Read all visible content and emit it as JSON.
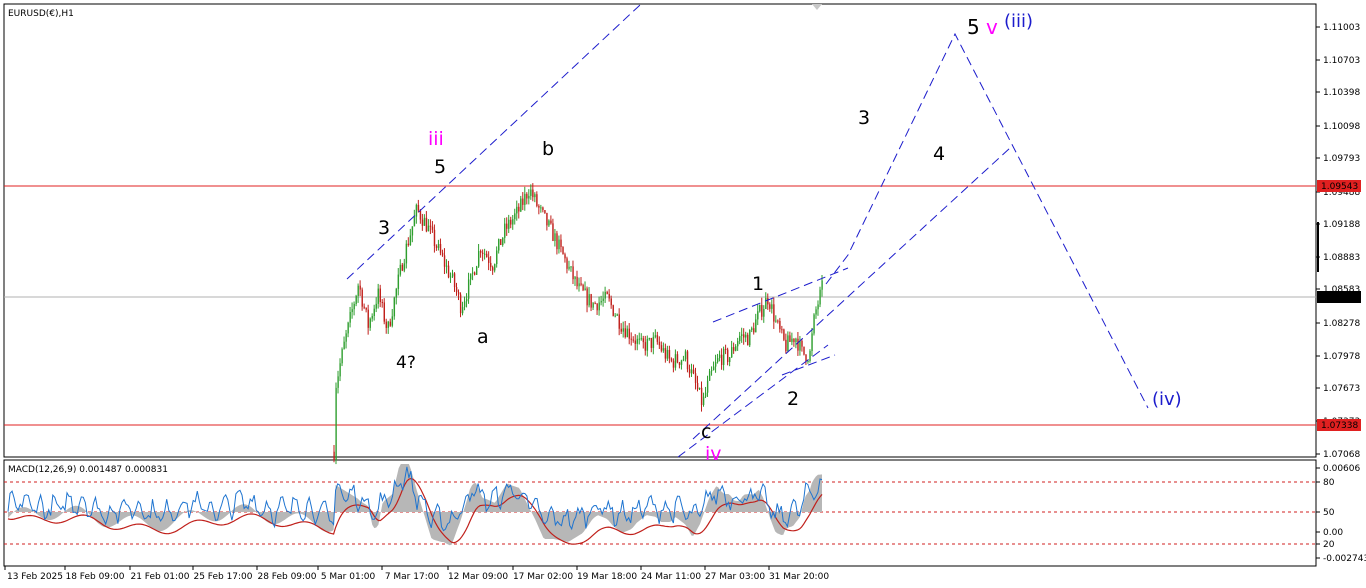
{
  "symbol_label": "EURUSD(€),H1",
  "indicator_label": "MACD(12,26,9) 0.001487 0.000831",
  "chart_data": [
    {
      "type": "candlestick",
      "title": "EURUSD(€),H1",
      "ylim": [
        1.0695,
        1.1125
      ],
      "price_ticks": [
        "1.11003",
        "1.10703",
        "1.10398",
        "1.10098",
        "1.09793",
        "1.09488",
        "1.09188",
        "1.08883",
        "1.08583",
        "1.08278",
        "1.07978",
        "1.07673",
        "1.07373",
        "1.07068"
      ],
      "time_ticks": [
        "13 Feb 2025",
        "18 Feb 09:00",
        "21 Feb 01:00",
        "25 Feb 17:00",
        "28 Feb 09:00",
        "5 Mar 01:00",
        "7 Mar 17:00",
        "12 Mar 09:00",
        "17 Mar 02:00",
        "19 Mar 18:00",
        "24 Mar 11:00",
        "27 Mar 03:00",
        "31 Mar 20:00"
      ],
      "horizontal_lines": [
        {
          "label": "1.09543",
          "color": "#e02020"
        },
        {
          "label": "1.07338",
          "color": "#e02020"
        },
        {
          "label": "1.08517",
          "color": "#b0b0b0"
        }
      ],
      "price_path": [
        {
          "t": 0.0,
          "p": 1.07
        },
        {
          "t": 0.004,
          "p": 1.0765
        },
        {
          "t": 0.02,
          "p": 1.08
        },
        {
          "t": 0.05,
          "p": 1.086
        },
        {
          "t": 0.07,
          "p": 1.082
        },
        {
          "t": 0.09,
          "p": 1.085
        },
        {
          "t": 0.11,
          "p": 1.0815
        },
        {
          "t": 0.14,
          "p": 1.088
        },
        {
          "t": 0.17,
          "p": 1.093
        },
        {
          "t": 0.19,
          "p": 1.0915
        },
        {
          "t": 0.22,
          "p": 1.0885
        },
        {
          "t": 0.245,
          "p": 1.086
        },
        {
          "t": 0.26,
          "p": 1.0838
        },
        {
          "t": 0.28,
          "p": 1.0862
        },
        {
          "t": 0.3,
          "p": 1.0895
        },
        {
          "t": 0.325,
          "p": 1.0878
        },
        {
          "t": 0.35,
          "p": 1.091
        },
        {
          "t": 0.38,
          "p": 1.093
        },
        {
          "t": 0.4,
          "p": 1.095
        },
        {
          "t": 0.42,
          "p": 1.093
        },
        {
          "t": 0.45,
          "p": 1.0905
        },
        {
          "t": 0.475,
          "p": 1.088
        },
        {
          "t": 0.5,
          "p": 1.0855
        },
        {
          "t": 0.53,
          "p": 1.084
        },
        {
          "t": 0.56,
          "p": 1.0845
        },
        {
          "t": 0.59,
          "p": 1.082
        },
        {
          "t": 0.63,
          "p": 1.08
        },
        {
          "t": 0.66,
          "p": 1.0805
        },
        {
          "t": 0.69,
          "p": 1.0785
        },
        {
          "t": 0.72,
          "p": 1.079
        },
        {
          "t": 0.755,
          "p": 1.0745
        },
        {
          "t": 0.77,
          "p": 1.077
        },
        {
          "t": 0.79,
          "p": 1.079
        },
        {
          "t": 0.81,
          "p": 1.079
        },
        {
          "t": 0.83,
          "p": 1.081
        },
        {
          "t": 0.85,
          "p": 1.0808
        },
        {
          "t": 0.87,
          "p": 1.083
        },
        {
          "t": 0.89,
          "p": 1.0847
        },
        {
          "t": 0.905,
          "p": 1.0823
        },
        {
          "t": 0.925,
          "p": 1.08
        },
        {
          "t": 0.945,
          "p": 1.081
        },
        {
          "t": 0.96,
          "p": 1.0793
        },
        {
          "t": 0.975,
          "p": 1.0792
        },
        {
          "t": 0.985,
          "p": 1.083
        },
        {
          "t": 1.0,
          "p": 1.0855
        }
      ],
      "annotations": [
        {
          "text": "iii",
          "color": "#ff00ff"
        },
        {
          "text": "5",
          "color": "#000000"
        },
        {
          "text": "3",
          "color": "#000000"
        },
        {
          "text": "4?",
          "color": "#000000"
        },
        {
          "text": "a",
          "color": "#000000"
        },
        {
          "text": "b",
          "color": "#000000"
        },
        {
          "text": "c",
          "color": "#000000"
        },
        {
          "text": "iv",
          "color": "#ff00ff"
        },
        {
          "text": "1",
          "color": "#000000"
        },
        {
          "text": "2",
          "color": "#000000"
        },
        {
          "text": "3",
          "color": "#000000"
        },
        {
          "text": "4",
          "color": "#000000"
        },
        {
          "text": "5",
          "color": "#000000"
        },
        {
          "text": "v",
          "color": "#ff00ff"
        },
        {
          "text": "(iii)",
          "color": "#1c1ccc"
        },
        {
          "text": "(iv)",
          "color": "#1c1ccc"
        }
      ]
    },
    {
      "type": "area",
      "title": "MACD(12,26,9) 0.001487 0.000831",
      "ylim": [
        -0.003,
        0.0065
      ],
      "y_ticks": [
        "0.00606",
        "80",
        "50",
        "0.00",
        "20",
        "-0.002743"
      ],
      "macd_value": 0.001487,
      "signal_value": 0.000831
    }
  ],
  "colors": {
    "bull": "#2e9e2e",
    "bear": "#c0201b",
    "projection": "#1c1ccc",
    "level": "#e02020",
    "macd_hist": "#b7b7b7",
    "signal": "#c0201b",
    "stoch": "#1e74d0"
  }
}
